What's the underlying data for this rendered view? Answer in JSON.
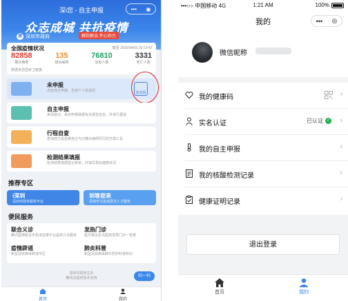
{
  "left_phone": {
    "nav_title": "深i您 - 自主申报",
    "capsule": [
      "•••",
      "◉"
    ],
    "slogan": "众志成城 共抗疫情",
    "gov_logo": "深",
    "gov_name": "深圳市政府",
    "gov_tag": "群防群治 齐心协力",
    "epidemic": {
      "title": "全国疫情状况",
      "time": "截至 2020/04/03 19:13:43",
      "stats": [
        {
          "num": "82858",
          "label": "确诊病例",
          "color": "#e03a2f"
        },
        {
          "num": "135",
          "label": "疑似病例",
          "color": "#f08a24"
        },
        {
          "num": "76810",
          "label": "治愈人数",
          "color": "#1aa260"
        },
        {
          "num": "3331",
          "label": "死亡人数",
          "color": "#333333"
        }
      ],
      "source": "数据来自国家卫健委"
    },
    "items": [
      {
        "name": "未申报",
        "desc": "点击自主申报，生成个人信息码",
        "thumb_color": "#7fb0f0",
        "qr_label": "信息码"
      },
      {
        "name": "自主申报",
        "desc": "来深登记、来访申报填报有关报告信息、并进行报送",
        "thumb_color": "#5cc0b0"
      },
      {
        "name": "行程自查",
        "desc": "查询自己是否乘坐过与已确诊病例同行的交通工具",
        "thumb_color": "#f3b25a"
      },
      {
        "name": "检测结果填报",
        "desc": "检测结果填报登记系统，并填写相关健康状况",
        "thumb_color": "#f19a5e"
      }
    ],
    "recommend_title": "推荐专区",
    "banners": [
      {
        "title": "i深圳",
        "sub": "深圳市政务服务平台",
        "color": "#3f86e6"
      },
      {
        "title": "圳等您来",
        "sub": "深圳市引进高层次人才服务",
        "color": "#5aa0f0"
      }
    ],
    "services_title": "便民服务",
    "services": [
      {
        "name": "联合义诊",
        "desc": "腾讯医典联合手机淘宝等平台提供义诊服务"
      },
      {
        "name": "发热门诊",
        "desc": "医疗救治定点医院发热门诊一览表"
      },
      {
        "name": "疫情辟谣",
        "desc": "新型冠状病毒辟谣专区"
      },
      {
        "name": "肺炎科普",
        "desc": "新型冠状病毒肺炎防护科普知识"
      }
    ],
    "footer_lines": [
      "深圳市政府主办",
      "腾讯云提供技术支持"
    ],
    "fab": "扫一扫",
    "tabs": [
      {
        "label": "首页",
        "icon": "home-icon",
        "active": true
      },
      {
        "label": "我的",
        "icon": "person-icon",
        "active": false
      }
    ]
  },
  "right_phone": {
    "status": {
      "carrier": "•••○○ 中国移动 4G",
      "time": "1:21 AM",
      "battery": "100%"
    },
    "nav_title": "我的",
    "capsule": [
      "•••",
      "◎"
    ],
    "nickname": "微信昵称",
    "menu": [
      {
        "label": "我的健康码",
        "icon": "heart-icon",
        "extra": "qr"
      },
      {
        "label": "实名认证",
        "icon": "person-icon",
        "extra": "verified",
        "badge": "已认证"
      },
      {
        "label": "我的自主申报",
        "icon": "thermometer-icon",
        "extra": ""
      },
      {
        "label": "我的核酸检测记录",
        "icon": "document-icon",
        "extra": ""
      },
      {
        "label": "健康证明记录",
        "icon": "clipboard-icon",
        "extra": ""
      }
    ],
    "logout": "退出登录",
    "tabs": [
      {
        "label": "首页",
        "icon": "home-icon",
        "active": false
      },
      {
        "label": "我的",
        "icon": "person-icon",
        "active": true
      }
    ]
  },
  "colors": {
    "accent": "#3b86ea",
    "highlight": "#e02020",
    "verified": "#22b14c"
  }
}
